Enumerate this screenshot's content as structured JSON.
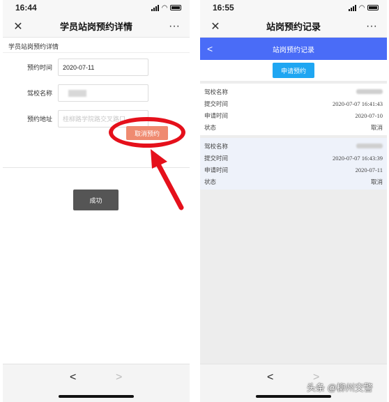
{
  "left": {
    "status_time": "16:44",
    "title": "学员站岗预约详情",
    "close_icon": "close-icon",
    "more_icon": "more-icon",
    "more_glyph": "···",
    "close_glyph": "✕",
    "section_title": "学员站岗预约详情",
    "form": {
      "time_label": "预约时间",
      "time_value": "2020-07-11",
      "school_label": "驾校名称",
      "address_label": "预约地址",
      "address_value": "桂柳路学院路交叉路口"
    },
    "cancel_button": "取消预约",
    "toast": "成功",
    "nav_back": "<",
    "nav_forward": ">"
  },
  "right": {
    "status_time": "16:55",
    "title": "站岗预约记录",
    "close_glyph": "✕",
    "more_glyph": "···",
    "blue_title": "站岗预约记录",
    "back_glyph": "<",
    "apply_button": "申请预约",
    "records": [
      {
        "school_label": "驾校名称",
        "submit_label": "提交时间",
        "submit_value": "2020-07-07 16:41:43",
        "apply_label": "申请时间",
        "apply_value": "2020-07-10",
        "status_label": "状态",
        "status_value": "取消"
      },
      {
        "school_label": "驾校名称",
        "submit_label": "提交时间",
        "submit_value": "2020-07-07 16:43:39",
        "apply_label": "申请时间",
        "apply_value": "2020-07-11",
        "status_label": "状态",
        "status_value": "取消"
      }
    ],
    "nav_back": "<",
    "nav_forward": ">"
  },
  "watermark": "头条 @柳州交警",
  "colors": {
    "highlight_red": "#e5101b",
    "cancel_button": "#ef8a70",
    "header_blue": "#4a6cf7",
    "apply_blue": "#1fa6f2"
  }
}
